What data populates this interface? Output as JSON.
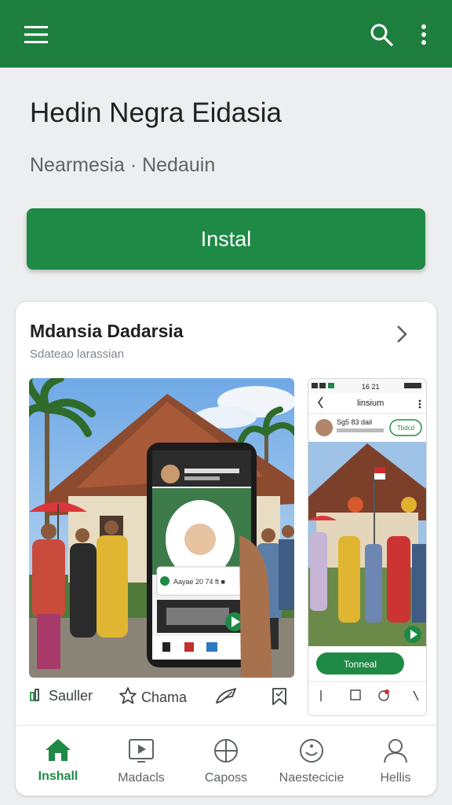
{
  "appbar": {
    "menu_icon": "hamburger-icon",
    "search_icon": "search-icon",
    "more_icon": "more-vert-icon",
    "color": "#1e7e3e"
  },
  "app": {
    "title": "Hedin Negra Eidasia",
    "subtitle": "Nearmesia · Nedauin",
    "install_label": "Instal",
    "accent": "#1e8a45"
  },
  "card": {
    "title": "Mdansia Dadarsia",
    "subtitle": "Sdateao larassian",
    "chevron_icon": "chevron-right-icon",
    "screenshot_main": {
      "post_text": "Aayae 20 74 ft ■"
    },
    "screenshot_side": {
      "status_time": "16 21",
      "header_title": "linsium",
      "user_line": "Sg5 83 dail",
      "follow_label": "Tbdcd",
      "caption": "Tonneal"
    },
    "actions": [
      {
        "label": "Sauller",
        "icon": "bar-chart-icon"
      },
      {
        "label": "Chama",
        "icon": "star-icon"
      },
      {
        "label": "",
        "icon": "share-icon"
      },
      {
        "label": "",
        "icon": "bookmark-icon"
      }
    ]
  },
  "bottom_nav": [
    {
      "label": "Inshall",
      "icon": "home-icon",
      "active": true
    },
    {
      "label": "Madacls",
      "icon": "play-icon",
      "active": false
    },
    {
      "label": "Caposs",
      "icon": "circle-plus-icon",
      "active": false
    },
    {
      "label": "Naestecicie",
      "icon": "smiley-icon",
      "active": false
    },
    {
      "label": "Hellis",
      "icon": "person-icon",
      "active": false
    }
  ]
}
